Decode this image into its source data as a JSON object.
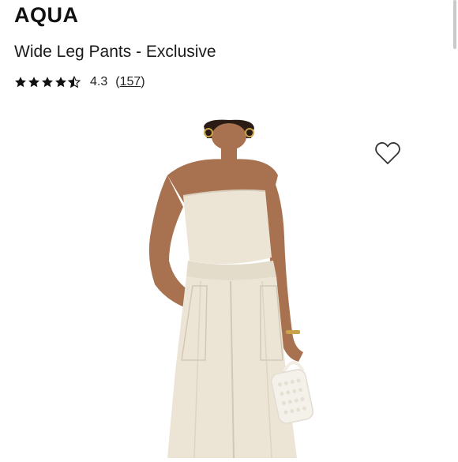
{
  "product": {
    "brand": "AQUA",
    "name": "Wide Leg Pants - Exclusive",
    "rating": {
      "value": "4.3",
      "stars": 4.3,
      "review_count_open": "(",
      "review_count": "157",
      "review_count_close": ")"
    }
  },
  "image": {
    "icon": "wishlist-heart-icon"
  },
  "colors": {
    "skin": "#a8714f",
    "garment": "#ece4d5",
    "text": "#111111"
  }
}
